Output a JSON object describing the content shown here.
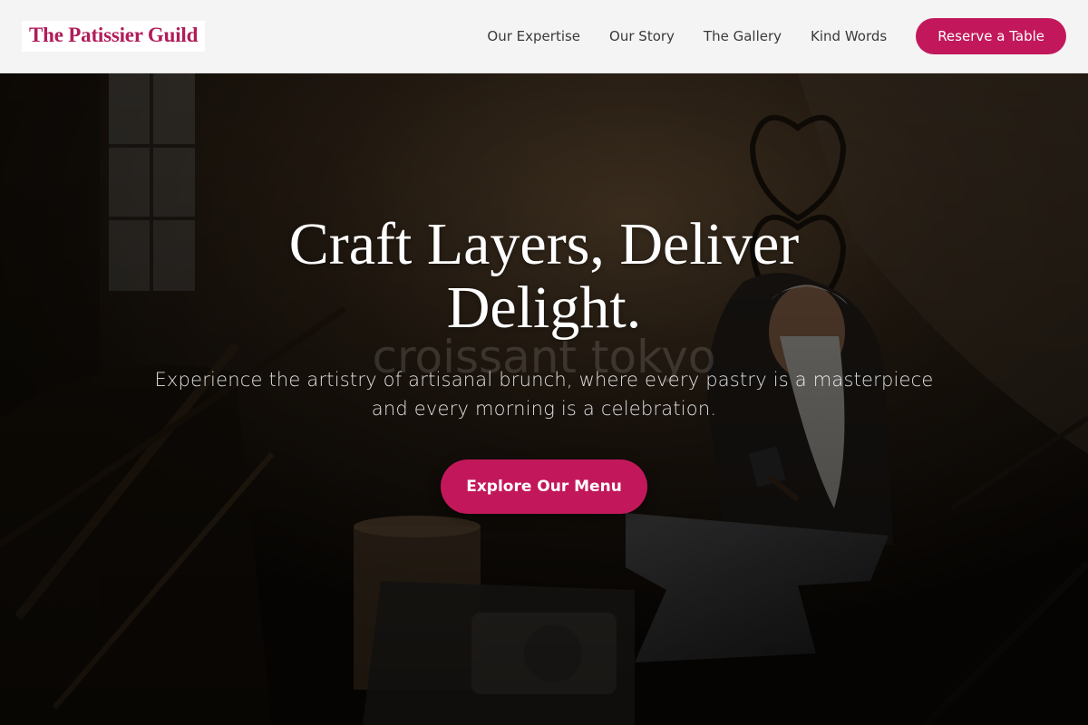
{
  "brand": {
    "name": "The Patissier Guild"
  },
  "nav": {
    "links": [
      "Our Expertise",
      "Our Story",
      "The Gallery",
      "Kind Words"
    ],
    "cta_label": "Reserve a Table"
  },
  "hero": {
    "title": "Craft Layers, Deliver Delight.",
    "subtitle": "Experience the artistry of artisanal brunch, where every pastry is a masterpiece and every morning is a celebration.",
    "cta_label": "Explore Our Menu",
    "watermark": "croissant tokyo"
  },
  "colors": {
    "accent": "#c2185b",
    "logo_text": "#b11c5a",
    "header_bg": "#f4f4f4",
    "nav_text": "#3a3a3a"
  }
}
